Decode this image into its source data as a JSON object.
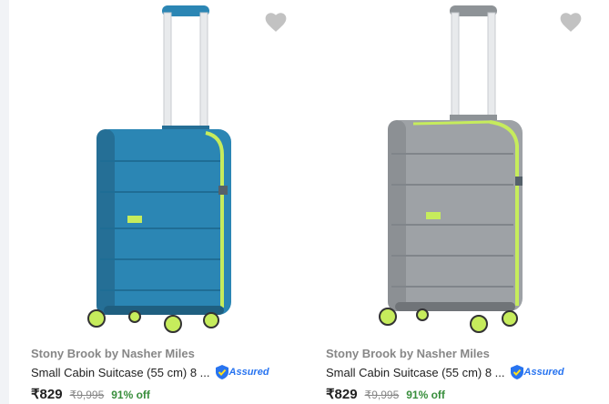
{
  "products": [
    {
      "brand": "Stony Brook by Nasher Miles",
      "title": "Small Cabin Suitcase (55 cm) 8 ...",
      "assured_label": "Assured",
      "price": "₹829",
      "mrp": "₹9,995",
      "discount": "91% off",
      "body_color": "#2b86b4",
      "accent_color": "#c6ec5c"
    },
    {
      "brand": "Stony Brook by Nasher Miles",
      "title": "Small Cabin Suitcase (55 cm) 8 ...",
      "assured_label": "Assured",
      "price": "₹829",
      "mrp": "₹9,995",
      "discount": "91% off",
      "body_color": "#9ea2a6",
      "accent_color": "#c6ec5c"
    }
  ],
  "colors": {
    "wishlist_heart": "#c2c2c2",
    "brand_text": "#878787",
    "discount_text": "#388e3c",
    "assured_blue": "#2874f0"
  },
  "icons": {
    "wishlist": "heart-icon",
    "assured": "shield-check-icon"
  }
}
